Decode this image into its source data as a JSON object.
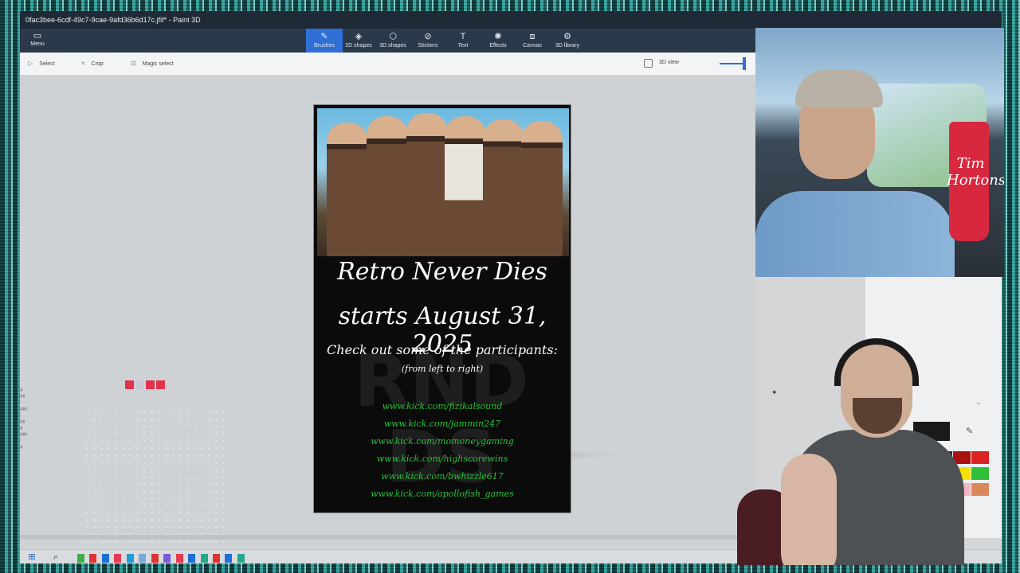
{
  "window": {
    "title": "0fac3bee-6cdf-49c7-9cae-9afd36b6d17c.jfif* - Paint 3D"
  },
  "ribbon": {
    "menu_label": "Menu",
    "tools": [
      {
        "label": "Brushes",
        "icon": "brush-icon",
        "active": true
      },
      {
        "label": "2D shapes",
        "icon": "2d-shapes-icon",
        "active": false
      },
      {
        "label": "3D shapes",
        "icon": "3d-shapes-icon",
        "active": false
      },
      {
        "label": "Stickers",
        "icon": "stickers-icon",
        "active": false
      },
      {
        "label": "Text",
        "icon": "text-icon",
        "active": false
      },
      {
        "label": "Effects",
        "icon": "effects-icon",
        "active": false
      },
      {
        "label": "Canvas",
        "icon": "canvas-icon",
        "active": false
      },
      {
        "label": "3D library",
        "icon": "3d-library-icon",
        "active": false
      }
    ]
  },
  "subbar": {
    "select_label": "Select",
    "crop_label": "Crop",
    "magic_select_label": "Magic select",
    "view3d_label": "3D view",
    "zoom_fraction": 0.9
  },
  "poster": {
    "title_line1": "Retro Never Dies",
    "title_line2": "starts August 31, 2025",
    "subtitle": "Check out some of the participants:",
    "note": "(from left to right)",
    "links": [
      "www.kick.com/fizikalsound",
      "www.kick.com/jammin247",
      "www.kick.com/momoneygaming",
      "www.kick.com/highscorewins",
      "www.kick.com/bwhizzle617",
      "www.kick.com/apollofish_games"
    ]
  },
  "webcam": {
    "cup_text": "Tim Hortons"
  },
  "colors": {
    "accent": "#2f6fd6",
    "link_green": "#27c23a",
    "ribbon_bg": "#2b3a4a"
  }
}
